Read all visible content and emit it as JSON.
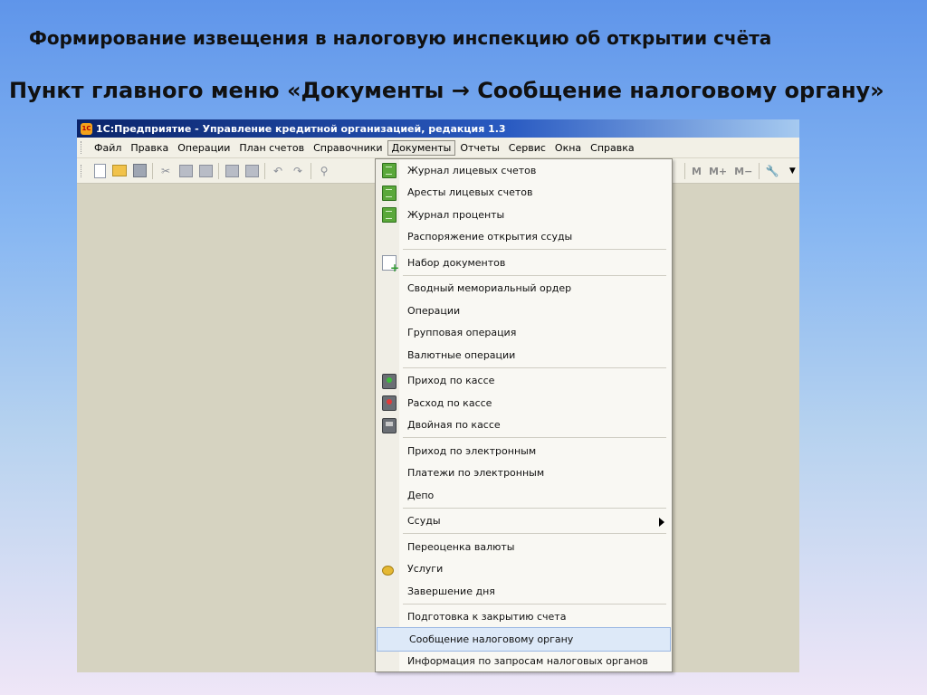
{
  "slide": {
    "title": "Формирование извещения в налоговую инспекцию об открытии счёта",
    "subtitle": "Пункт главного меню «Документы → Сообщение налоговому органу»"
  },
  "window": {
    "title": "1С:Предприятие - Управление кредитной организацией, редакция 1.3",
    "logo_text": "1С"
  },
  "menubar": [
    "Файл",
    "Правка",
    "Операции",
    "План счетов",
    "Справочники",
    "Документы",
    "Отчеты",
    "Сервис",
    "Окна",
    "Справка"
  ],
  "toolbar": {
    "left_icons": [
      "new-document-icon",
      "open-folder-icon",
      "save-icon",
      "cut-icon",
      "copy-icon",
      "paste-icon",
      "print-icon",
      "print-preview-icon",
      "undo-icon",
      "redo-icon",
      "find-icon"
    ],
    "right_labels": [
      "M",
      "M+",
      "M−"
    ]
  },
  "documents_menu": {
    "groups": [
      [
        {
          "label": "Журнал лицевых счетов",
          "icon": "journal-icon"
        },
        {
          "label": "Аресты лицевых счетов",
          "icon": "journal-icon"
        },
        {
          "label": "Журнал проценты",
          "icon": "journal-icon"
        },
        {
          "label": "Распоряжение открытия ссуды",
          "icon": ""
        }
      ],
      [
        {
          "label": "Набор документов",
          "icon": "document-set-icon"
        }
      ],
      [
        {
          "label": "Сводный мемориальный ордер",
          "icon": ""
        },
        {
          "label": "Операции",
          "icon": ""
        },
        {
          "label": "Групповая операция",
          "icon": ""
        },
        {
          "label": "Валютные операции",
          "icon": ""
        }
      ],
      [
        {
          "label": "Приход по кассе",
          "icon": "cash-in-icon"
        },
        {
          "label": "Расход по кассе",
          "icon": "cash-out-icon"
        },
        {
          "label": "Двойная по кассе",
          "icon": "cash-double-icon"
        }
      ],
      [
        {
          "label": "Приход по электронным",
          "icon": ""
        },
        {
          "label": "Платежи по электронным",
          "icon": ""
        },
        {
          "label": "Депо",
          "icon": ""
        }
      ],
      [
        {
          "label": "Ссуды",
          "icon": "",
          "submenu": true
        }
      ],
      [
        {
          "label": "Переоценка валюты",
          "icon": ""
        },
        {
          "label": "Услуги",
          "icon": "coins-icon"
        },
        {
          "label": "Завершение дня",
          "icon": ""
        }
      ],
      [
        {
          "label": "Подготовка к закрытию счета",
          "icon": ""
        },
        {
          "label": "Сообщение налоговому органу",
          "icon": "",
          "highlighted": true
        },
        {
          "label": "Информация по запросам налоговых органов",
          "icon": ""
        }
      ]
    ]
  }
}
